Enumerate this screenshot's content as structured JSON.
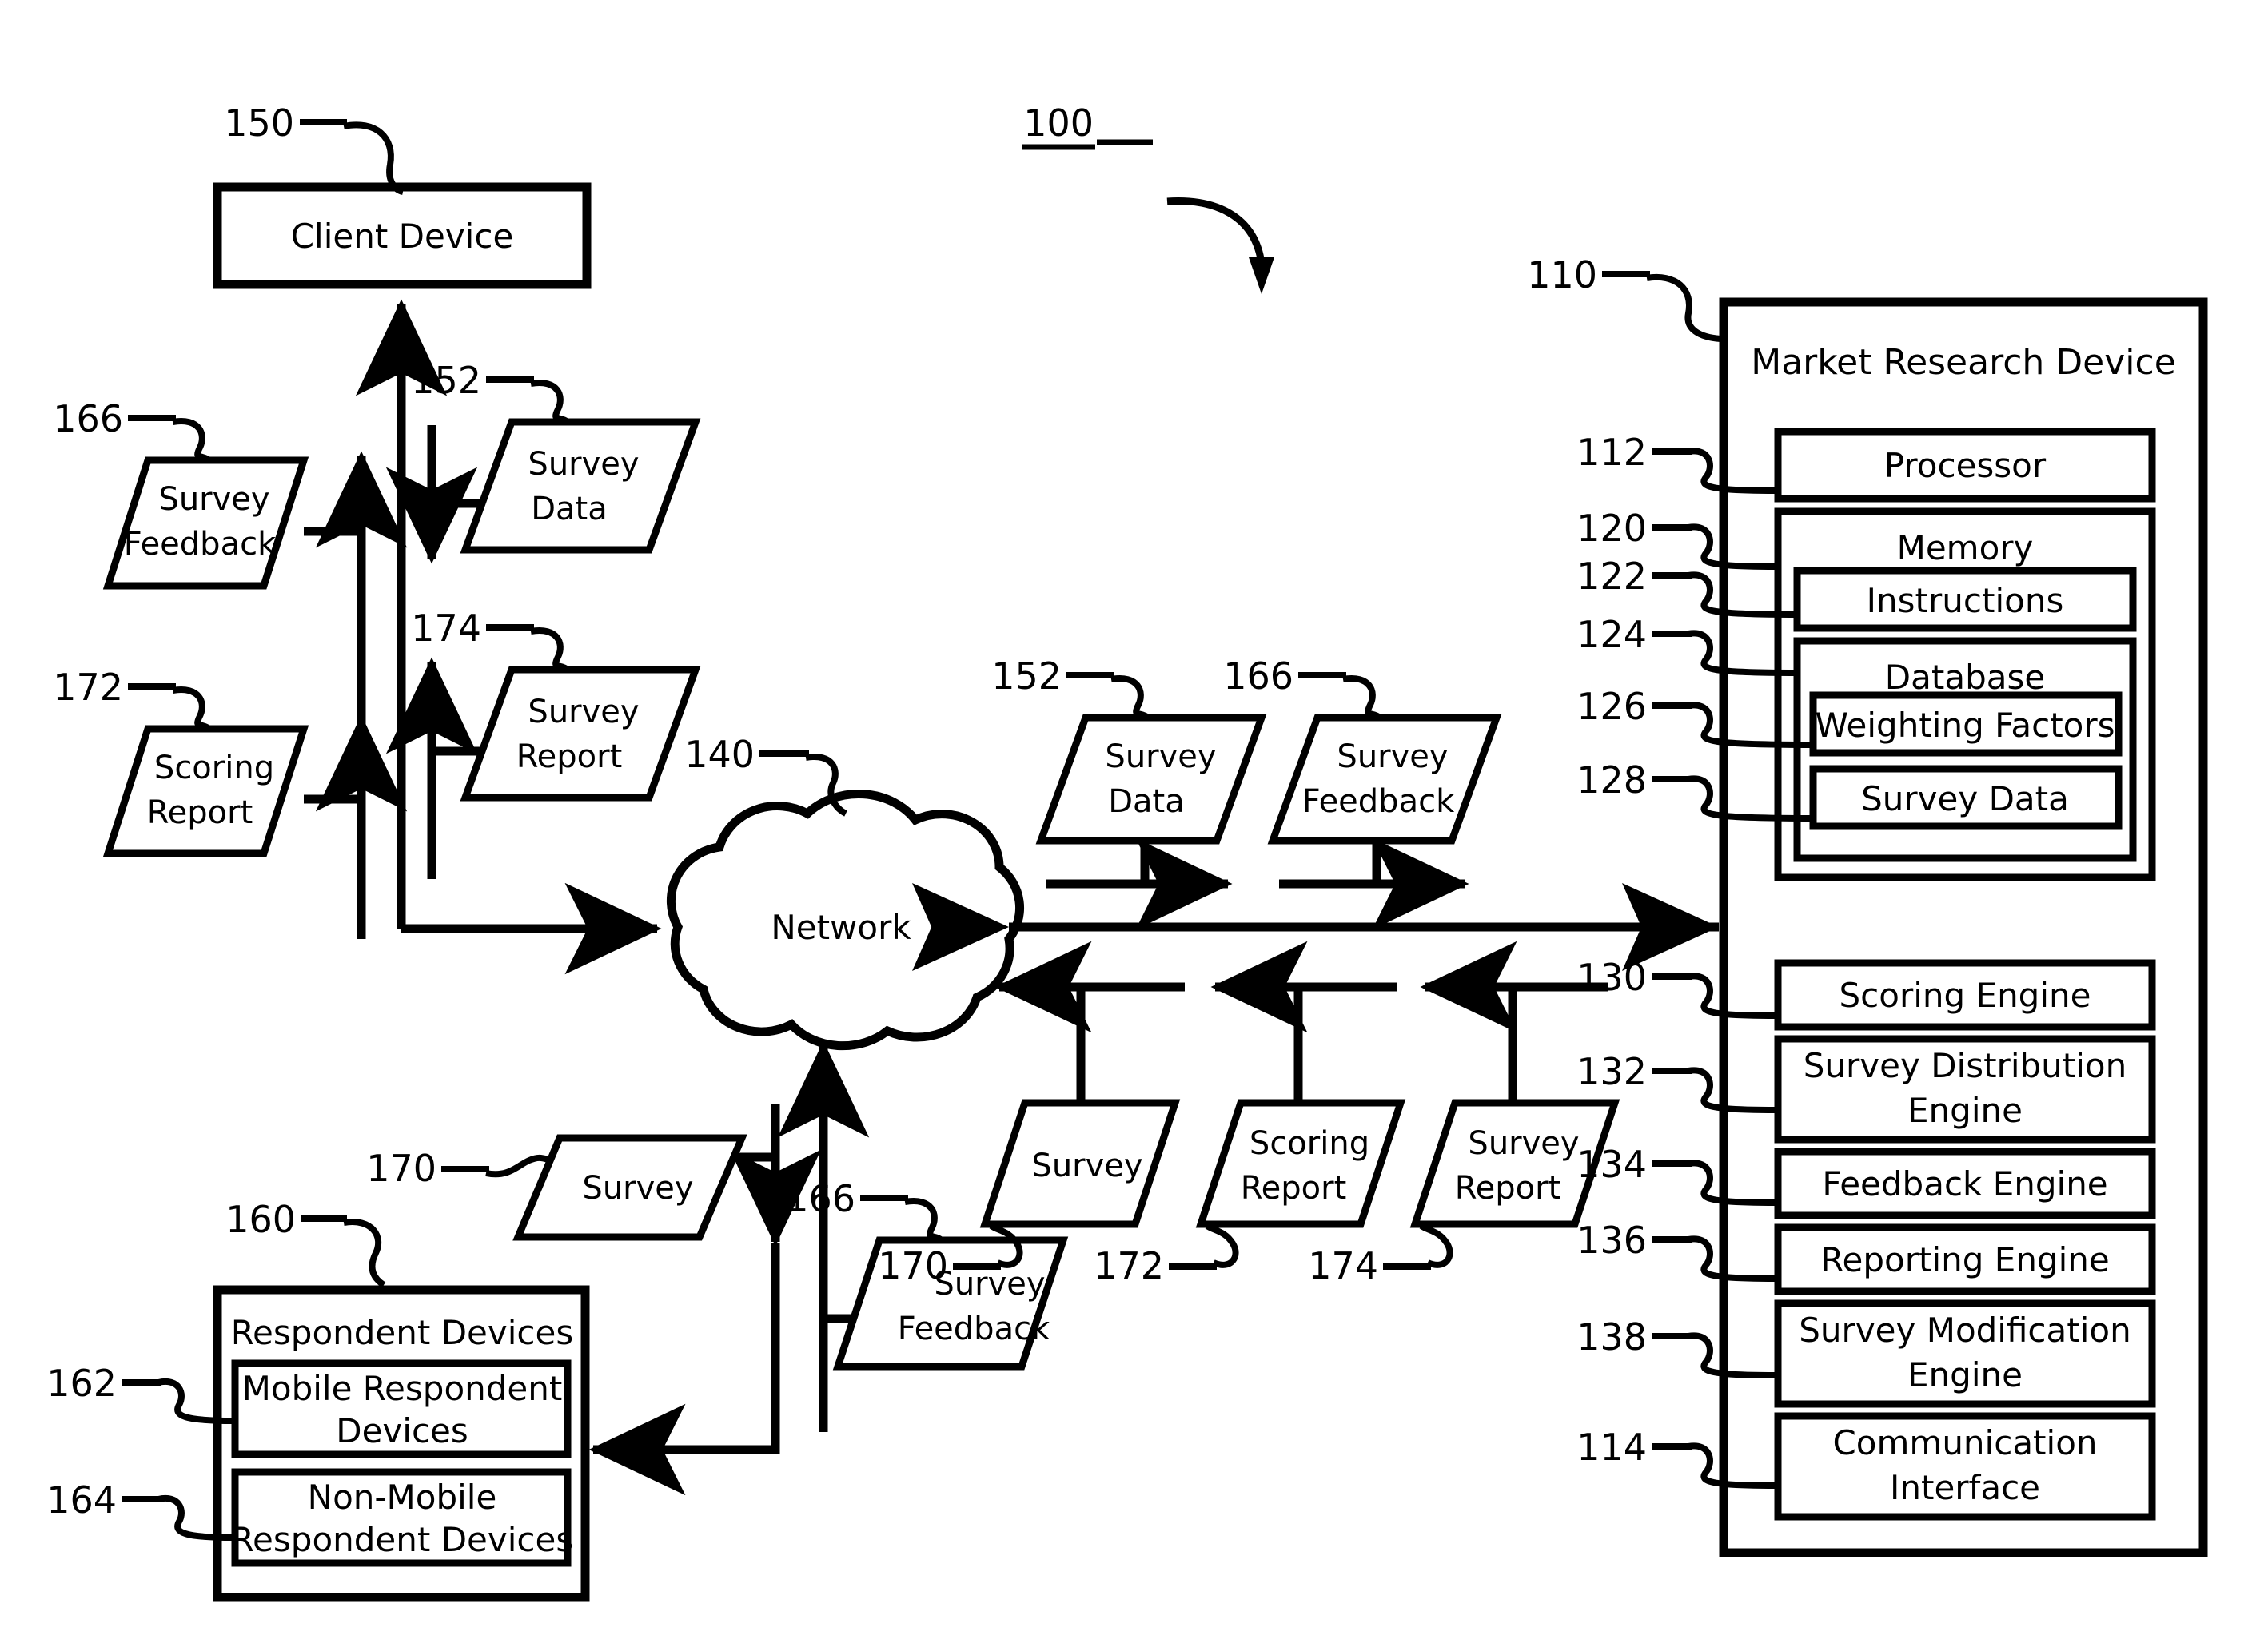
{
  "figure": {
    "system_ref": "100",
    "nodes": {
      "client_device": {
        "ref": "150",
        "label": "Client Device"
      },
      "market_research_device": {
        "ref": "110",
        "label": "Market Research Device"
      },
      "processor": {
        "ref": "112",
        "label": "Processor"
      },
      "memory": {
        "ref": "120",
        "label": "Memory"
      },
      "instructions": {
        "ref": "122",
        "label": "Instructions"
      },
      "database": {
        "ref": "124",
        "label": "Database"
      },
      "weighting_factors": {
        "ref": "126",
        "label": "Weighting Factors"
      },
      "survey_data_store": {
        "ref": "128",
        "label": "Survey Data"
      },
      "scoring_engine": {
        "ref": "130",
        "label": "Scoring Engine"
      },
      "survey_distribution_engine": {
        "ref": "132",
        "label": "Survey Distribution Engine"
      },
      "feedback_engine": {
        "ref": "134",
        "label": "Feedback Engine"
      },
      "reporting_engine": {
        "ref": "136",
        "label": "Reporting Engine"
      },
      "survey_modification_engine": {
        "ref": "138",
        "label": "Survey Modification Engine"
      },
      "communication_interface": {
        "ref": "114",
        "label": "Communication Interface"
      },
      "network": {
        "ref": "140",
        "label": "Network"
      },
      "respondent_devices": {
        "ref": "160",
        "label": "Respondent Devices"
      },
      "mobile_respondent_devices": {
        "ref": "162",
        "label": "Mobile Respondent Devices"
      },
      "non_mobile_respondent_devices": {
        "ref": "164",
        "label": "Non-Mobile Respondent Devices"
      }
    },
    "artifacts": [
      {
        "id": "survey-feedback-left",
        "ref": "166",
        "line1": "Survey",
        "line2": "Feedback"
      },
      {
        "id": "survey-data-left",
        "ref": "152",
        "line1": "Survey",
        "line2": "Data"
      },
      {
        "id": "scoring-report-left",
        "ref": "172",
        "line1": "Scoring",
        "line2": "Report"
      },
      {
        "id": "survey-report-left",
        "ref": "174",
        "line1": "Survey",
        "line2": "Report"
      },
      {
        "id": "survey-data-mid",
        "ref": "152",
        "line1": "Survey",
        "line2": "Data"
      },
      {
        "id": "survey-feedback-mid",
        "ref": "166",
        "line1": "Survey",
        "line2": "Feedback"
      },
      {
        "id": "survey-mid",
        "ref": "170",
        "line1": "Survey",
        "line2": ""
      },
      {
        "id": "scoring-report-mid",
        "ref": "172",
        "line1": "Scoring",
        "line2": "Report"
      },
      {
        "id": "survey-report-mid",
        "ref": "174",
        "line1": "Survey",
        "line2": "Report"
      },
      {
        "id": "survey-bottom",
        "ref": "170",
        "line1": "Survey",
        "line2": ""
      },
      {
        "id": "survey-feedback-bottom",
        "ref": "166",
        "line1": "Survey",
        "line2": "Feedback"
      }
    ],
    "stroke_color": "#000000",
    "background_color": "#ffffff"
  }
}
